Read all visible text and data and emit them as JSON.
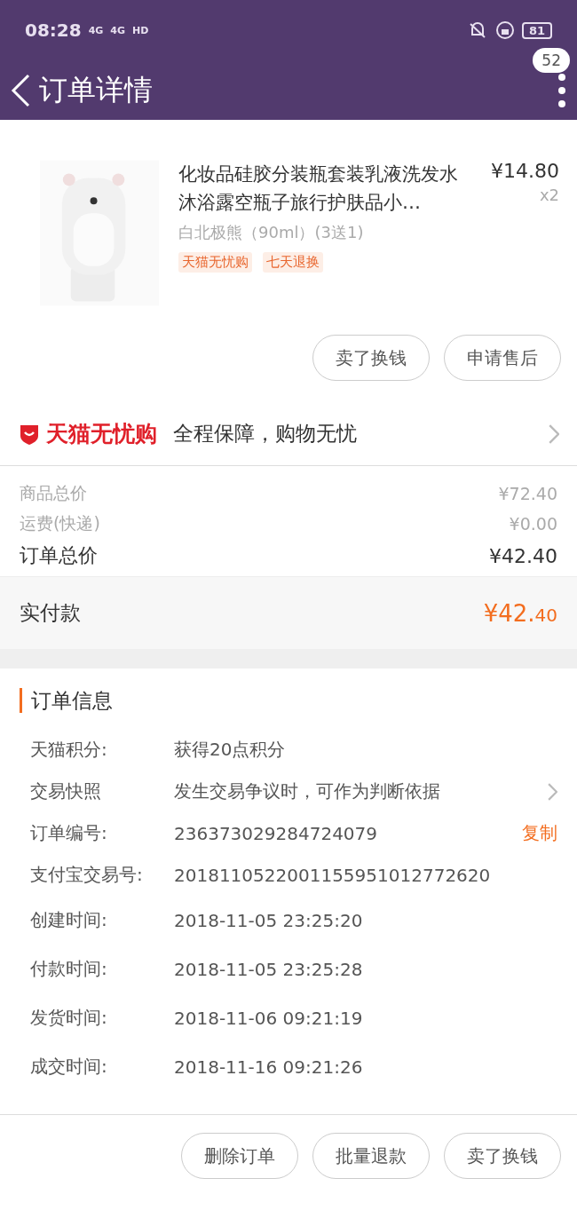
{
  "status_bar": {
    "time": "08:28",
    "signal_1": "4G",
    "signal_2": "4G",
    "hd": "HD",
    "battery": "81"
  },
  "nav": {
    "title": "订单详情",
    "badge": "52"
  },
  "product": {
    "kind": "picture",
    "title": "化妆品硅胶分装瓶套装乳液洗发水沐浴露空瓶子旅行护肤品小…",
    "price": "¥14.80",
    "quantity": "x2",
    "variant": "白北极熊（90ml）(3送1)",
    "tags": [
      "天猫无忧购",
      "七天退换"
    ],
    "buttons": [
      "卖了换钱",
      "申请售后"
    ]
  },
  "guarantee": {
    "brand": "天猫无忧购",
    "text": "全程保障，购物无忧"
  },
  "totals": [
    {
      "kind": "minor",
      "label": "商品总价",
      "value": "¥72.40"
    },
    {
      "kind": "minor",
      "label": "运费(快递)",
      "value": "¥0.00"
    },
    {
      "kind": "major",
      "label": "订单总价",
      "value": "¥42.40"
    }
  ],
  "paid": {
    "label": "实付款",
    "value_main": "¥42.",
    "value_cents": "40"
  },
  "order_info": {
    "heading": "订单信息",
    "rows": [
      {
        "label": "天猫积分:",
        "value": "获得20点积分"
      },
      {
        "label": "交易快照",
        "value": "发生交易争议时，可作为判断依据",
        "kind": "chevron"
      },
      {
        "label": "订单编号:",
        "value": "236373029284724079",
        "kind": "link",
        "action": "复制"
      },
      {
        "label": "支付宝交易号:",
        "value": "2018110522001155951012772620"
      },
      {
        "label": "创建时间:",
        "value": "2018-11-05 23:25:20"
      },
      {
        "label": "付款时间:",
        "value": "2018-11-05 23:25:28"
      },
      {
        "label": "发货时间:",
        "value": "2018-11-06 09:21:19"
      },
      {
        "label": "成交时间:",
        "value": "2018-11-16 09:21:26"
      }
    ]
  },
  "bottom_buttons": [
    "删除订单",
    "批量退款",
    "卖了换钱"
  ]
}
